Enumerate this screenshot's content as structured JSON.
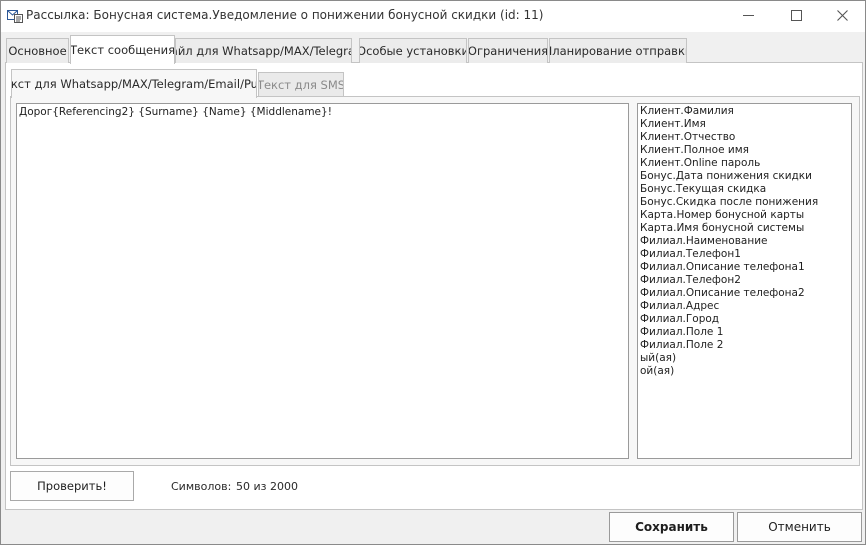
{
  "window": {
    "title": "Рассылка: Бонусная система.Уведомление о понижении бонусной скидки (id: 11)",
    "icon": "mail-form-icon",
    "controls": {
      "minimize": "minimize-icon",
      "maximize": "maximize-icon",
      "close": "close-icon"
    }
  },
  "tabs": [
    {
      "label": "Основное",
      "active": false
    },
    {
      "label": "Текст сообщения",
      "active": true
    },
    {
      "label": "Файл для Whatsapp/MAX/Telegram",
      "active": false
    },
    {
      "label": "Особые установки",
      "active": false
    },
    {
      "label": "Ограничения",
      "active": false
    },
    {
      "label": "Планирование отправки",
      "active": false
    }
  ],
  "subtabs": [
    {
      "label": "Текст для Whatsapp/MAX/Telegram/Email/Push",
      "active": true
    },
    {
      "label": "Текст для SMS",
      "active": false
    }
  ],
  "message": {
    "text": "Дорог{Referencing2} {Surname} {Name} {Middlename}!"
  },
  "fields": [
    "Клиент.Фамилия",
    "Клиент.Имя",
    "Клиент.Отчество",
    "Клиент.Полное имя",
    "Клиент.Online пароль",
    "Бонус.Дата понижения скидки",
    "Бонус.Текущая скидка",
    "Бонус.Скидка после понижения",
    "Карта.Номер бонусной карты",
    "Карта.Имя бонусной системы",
    "Филиал.Наименование",
    "Филиал.Телефон1",
    "Филиал.Описание телефона1",
    "Филиал.Телефон2",
    "Филиал.Описание телефона2",
    "Филиал.Адрес",
    "Филиал.Город",
    "Филиал.Поле 1",
    "Филиал.Поле 2",
    "ый(ая)",
    "ой(ая)"
  ],
  "footer": {
    "check_label": "Проверить!",
    "chars_label": "Символов:",
    "chars_value": "50 из 2000",
    "save_label": "Сохранить",
    "cancel_label": "Отменить"
  },
  "colors": {
    "window_bg": "#f0f0f0",
    "border": "#c4c4c4",
    "text": "#1e1e1e",
    "inactive_text": "#8a8a8a"
  }
}
